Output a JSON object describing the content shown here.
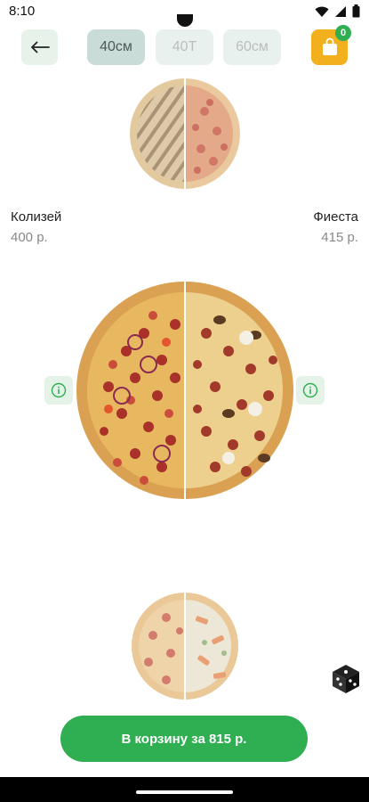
{
  "status_bar": {
    "time": "8:10"
  },
  "top_bar": {
    "size_tabs": [
      {
        "label": "40см",
        "active": true
      },
      {
        "label": "40Т",
        "active": false
      },
      {
        "label": "60см",
        "active": false
      }
    ],
    "cart_count": "0"
  },
  "left_pizza": {
    "name": "Колизей",
    "price": "400 р."
  },
  "right_pizza": {
    "name": "Фиеста",
    "price": "415 р."
  },
  "cta": {
    "label": "В корзину за 815 р."
  },
  "icons": {
    "back": "arrow-left-icon",
    "cart": "shopping-bag-icon",
    "info": "info-icon",
    "random": "dice-icon"
  },
  "colors": {
    "accent_green": "#2fae52",
    "cart_yellow": "#f2b01e",
    "tab_active": "#c9dcd7",
    "tab_inactive": "#e9f1ee"
  }
}
